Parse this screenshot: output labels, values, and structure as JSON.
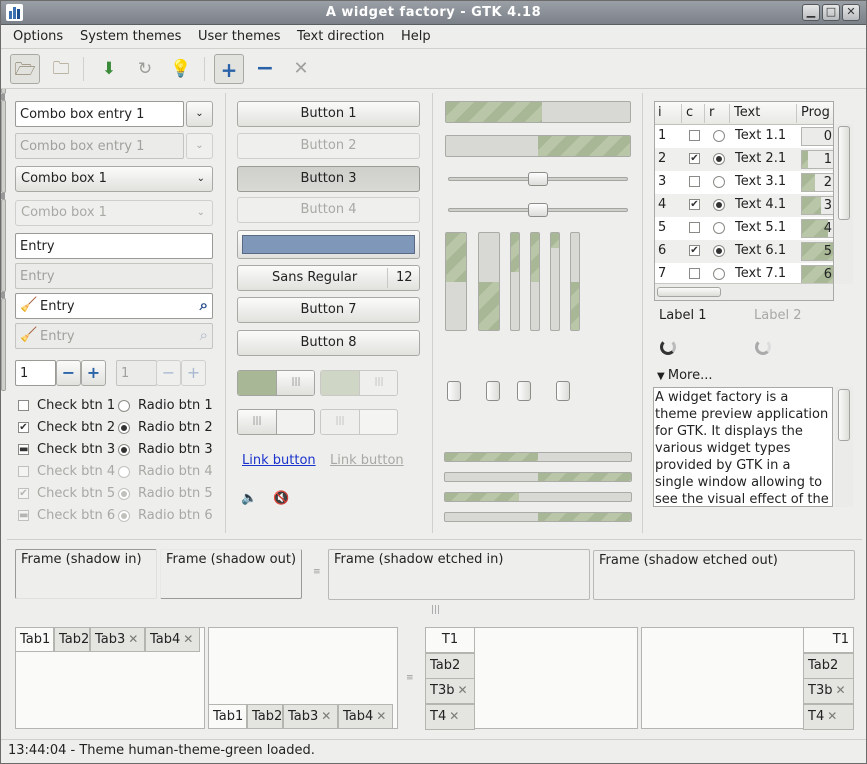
{
  "window": {
    "title": "A widget factory - GTK 4.18"
  },
  "menubar": {
    "items": [
      "Options",
      "System themes",
      "User themes",
      "Text direction",
      "Help"
    ]
  },
  "toolbar": {
    "icons": [
      "folder-open-icon",
      "folder-icon",
      "download-icon",
      "refresh-icon",
      "lightbulb-icon",
      "add-icon",
      "remove-icon",
      "close-icon"
    ]
  },
  "col1": {
    "combo_entry_1": "Combo box entry 1",
    "combo_entry_1_dis": "Combo box entry 1",
    "combo_1": "Combo box 1",
    "combo_1_dis": "Combo box 1",
    "entry": "Entry",
    "entry_dis_placeholder": "Entry",
    "search_entry": "Entry",
    "search_entry_dis": "Entry",
    "spin_value": "1",
    "spin_value_dis": "1",
    "checks": [
      "Check btn 1",
      "Check btn 2",
      "Check btn 3",
      "Check btn 4",
      "Check btn 5",
      "Check btn 6"
    ],
    "radios": [
      "Radio btn 1",
      "Radio btn 2",
      "Radio btn 3",
      "Radio btn 4",
      "Radio btn 5",
      "Radio btn 6"
    ]
  },
  "col2": {
    "buttons": [
      "Button 1",
      "Button 2",
      "Button 3",
      "Button 4"
    ],
    "font_name": "Sans Regular",
    "font_size": "12",
    "button7": "Button 7",
    "button8": "Button 8",
    "link": "Link button",
    "link_dis": "Link button",
    "color_swatch": "#7f97b9"
  },
  "col3": {
    "progress": [
      0.52,
      0.5
    ],
    "hscales": [
      0.5,
      0.5
    ],
    "vprogress": [
      0.5,
      0.5,
      0.4,
      0.5,
      0.15,
      0.5,
      0.2
    ],
    "levelbars": [
      0.5,
      0.5,
      0.4,
      0.5
    ]
  },
  "col4": {
    "tree_headers": [
      "i",
      "c",
      "r",
      "Text",
      "Prog"
    ],
    "tree_rows": [
      {
        "i": "1",
        "text": "Text 1.1",
        "prog": "0",
        "check": false,
        "radio": false,
        "pct": 0.0
      },
      {
        "i": "2",
        "text": "Text 2.1",
        "prog": "1",
        "check": true,
        "radio": true,
        "pct": 0.2
      },
      {
        "i": "3",
        "text": "Text 3.1",
        "prog": "2",
        "check": false,
        "radio": false,
        "pct": 0.4
      },
      {
        "i": "4",
        "text": "Text 4.1",
        "prog": "3",
        "check": true,
        "radio": true,
        "pct": 0.6
      },
      {
        "i": "5",
        "text": "Text 5.1",
        "prog": "4",
        "check": false,
        "radio": false,
        "pct": 0.8
      },
      {
        "i": "6",
        "text": "Text 6.1",
        "prog": "5",
        "check": true,
        "radio": true,
        "pct": 1.0
      },
      {
        "i": "7",
        "text": "Text 7.1",
        "prog": "6",
        "check": false,
        "radio": false,
        "pct": 1.0
      }
    ],
    "label1": "Label 1",
    "label2": "Label 2",
    "expander": "More...",
    "text_view": "A widget factory is a theme preview application for GTK. It displays the various widget types provided by GTK in a single window allowing to see the visual effect of the applied"
  },
  "frames": [
    "Frame (shadow in)",
    "Frame (shadow out)",
    "Frame (shadow etched in)",
    "Frame (shadow etched out)"
  ],
  "notebooks": {
    "tabs": [
      "Tab1",
      "Tab2",
      "Tab3",
      "Tab4"
    ],
    "vtabs": [
      "T1",
      "Tab2",
      "T3b",
      "T4"
    ]
  },
  "statusbar": {
    "text": "13:44:04 - Theme human-theme-green loaded."
  },
  "colors": {
    "accent_green": "#a8b896",
    "title_bar": "#8a9097",
    "link": "#1a33cc"
  }
}
